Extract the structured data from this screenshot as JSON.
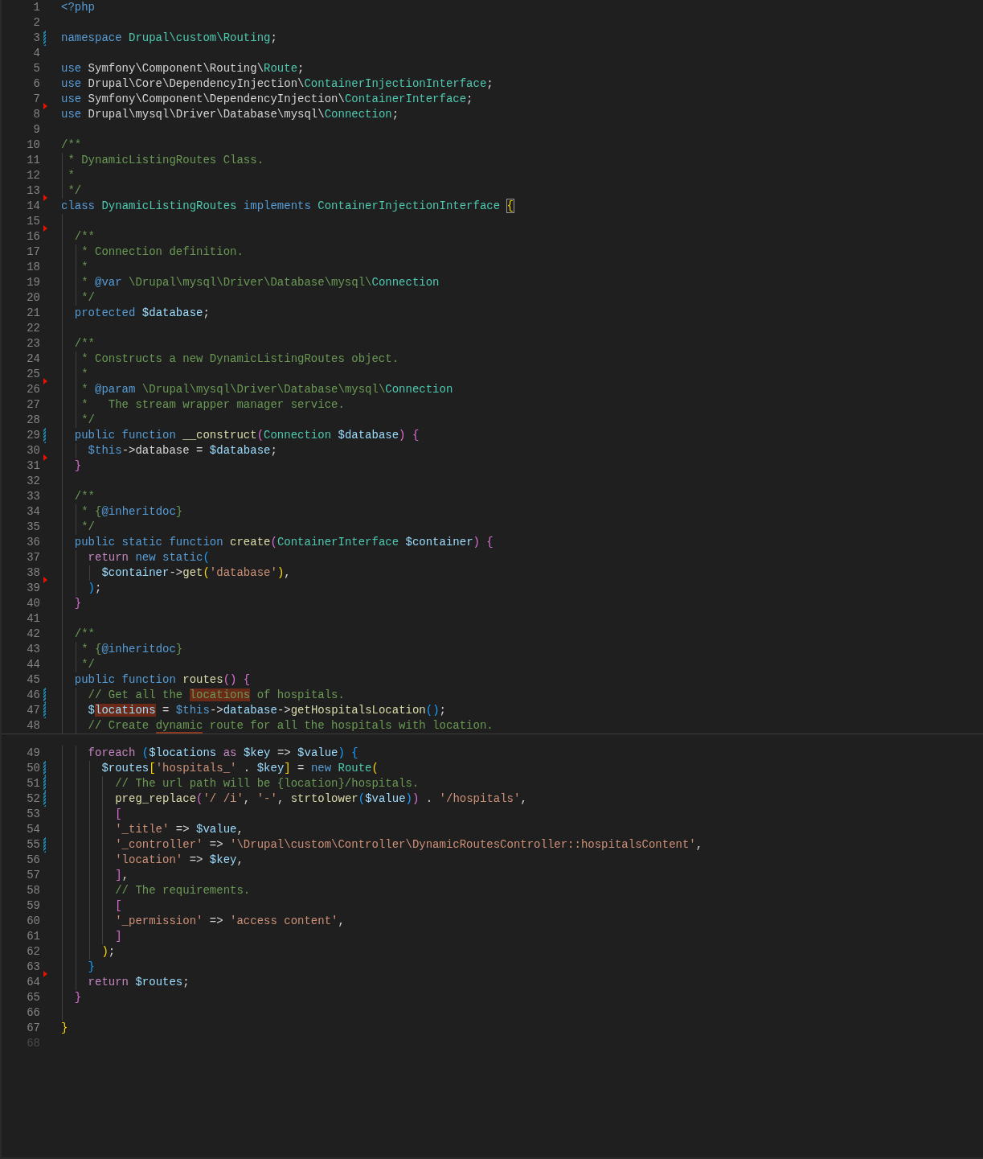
{
  "editor": {
    "sections": [
      {
        "lines": [
          {
            "number": "1",
            "modified": false,
            "marker": false,
            "dimmed": false,
            "tokens": [
              {
                "text": "<?php",
                "kind": "keyword"
              }
            ]
          },
          {
            "number": "2",
            "modified": false,
            "marker": false,
            "dimmed": false
          },
          {
            "number": "3",
            "modified": true,
            "marker": false,
            "dimmed": false,
            "tokens": [
              {
                "text": "namespace ",
                "kind": "keyword"
              },
              {
                "text": "Drupal\\custom\\Routing",
                "kind": "type"
              },
              {
                "text": ";",
                "kind": "plain"
              }
            ]
          },
          {
            "number": "4",
            "modified": false,
            "marker": false,
            "dimmed": false
          },
          {
            "number": "5",
            "modified": false,
            "marker": false,
            "dimmed": false,
            "tokens": [
              {
                "text": "use ",
                "kind": "keyword"
              },
              {
                "text": "Symfony\\Component\\Routing\\",
                "kind": "plain"
              },
              {
                "text": "Route",
                "kind": "type"
              },
              {
                "text": ";",
                "kind": "plain"
              }
            ]
          },
          {
            "number": "6",
            "modified": false,
            "marker": false,
            "dimmed": false,
            "tokens": [
              {
                "text": "use ",
                "kind": "keyword"
              },
              {
                "text": "Drupal\\Core\\DependencyInjection\\",
                "kind": "plain"
              },
              {
                "text": "ContainerInjectionInterface",
                "kind": "type"
              },
              {
                "text": ";",
                "kind": "plain"
              }
            ]
          },
          {
            "number": "7",
            "modified": false,
            "marker": false,
            "dimmed": false,
            "tokens": [
              {
                "text": "use ",
                "kind": "keyword"
              },
              {
                "text": "Symfony\\Component\\DependencyInjection\\",
                "kind": "plain"
              },
              {
                "text": "ContainerInterface",
                "kind": "type"
              },
              {
                "text": ";",
                "kind": "plain"
              }
            ]
          },
          {
            "number": "8",
            "modified": false,
            "marker": true,
            "dimmed": false,
            "tokens": [
              {
                "text": "use ",
                "kind": "keyword"
              },
              {
                "text": "Drupal\\mysql\\Driver\\Database\\mysql\\",
                "kind": "plain"
              },
              {
                "text": "Connection",
                "kind": "type"
              },
              {
                "text": ";",
                "kind": "plain"
              }
            ]
          },
          {
            "number": "9",
            "modified": false,
            "marker": false,
            "dimmed": false
          },
          {
            "number": "10",
            "modified": false,
            "marker": false,
            "dimmed": false,
            "tokens": [
              {
                "text": "/**",
                "kind": "comment"
              }
            ]
          },
          {
            "number": "11",
            "modified": false,
            "marker": false,
            "dimmed": false,
            "tokens": [
              {
                "text": " * DynamicListingRoutes Class.",
                "kind": "comment"
              }
            ]
          },
          {
            "number": "12",
            "modified": false,
            "marker": false,
            "dimmed": false,
            "tokens": [
              {
                "text": " *",
                "kind": "comment"
              }
            ]
          },
          {
            "number": "13",
            "modified": false,
            "marker": false,
            "dimmed": false,
            "tokens": [
              {
                "text": " */",
                "kind": "comment"
              }
            ]
          },
          {
            "number": "14",
            "modified": false,
            "marker": true,
            "dimmed": false,
            "tokens": [
              {
                "text": "class ",
                "kind": "keyword"
              },
              {
                "text": "DynamicListingRoutes ",
                "kind": "type"
              },
              {
                "text": "implements ",
                "kind": "keyword"
              },
              {
                "text": "ContainerInjectionInterface ",
                "kind": "type"
              },
              {
                "text": "{",
                "kind": "bracket_boxed"
              }
            ]
          },
          {
            "number": "15",
            "modified": false,
            "marker": false,
            "dimmed": false
          },
          {
            "number": "16",
            "modified": false,
            "marker": true,
            "dimmed": false,
            "tokens": [
              {
                "text": "  /**",
                "kind": "comment"
              }
            ]
          },
          {
            "number": "17",
            "modified": false,
            "marker": false,
            "dimmed": false,
            "tokens": [
              {
                "text": "   * Connection definition.",
                "kind": "comment"
              }
            ]
          },
          {
            "number": "18",
            "modified": false,
            "marker": false,
            "dimmed": false,
            "tokens": [
              {
                "text": "   *",
                "kind": "comment"
              }
            ]
          },
          {
            "number": "19",
            "modified": false,
            "marker": false,
            "dimmed": false,
            "tokens": [
              {
                "text": "   * ",
                "kind": "comment"
              },
              {
                "text": "@var",
                "kind": "keyword"
              },
              {
                "text": " \\Drupal\\mysql\\Driver\\Database\\mysql\\",
                "kind": "comment"
              },
              {
                "text": "Connection",
                "kind": "type"
              }
            ]
          },
          {
            "number": "20",
            "modified": false,
            "marker": false,
            "dimmed": false,
            "tokens": [
              {
                "text": "   */",
                "kind": "comment"
              }
            ]
          },
          {
            "number": "21",
            "modified": false,
            "marker": false,
            "dimmed": false,
            "tokens": [
              {
                "text": "  protected ",
                "kind": "keyword"
              },
              {
                "text": "$database",
                "kind": "variable"
              },
              {
                "text": ";",
                "kind": "plain"
              }
            ]
          },
          {
            "number": "22",
            "modified": false,
            "marker": false,
            "dimmed": false
          },
          {
            "number": "23",
            "modified": false,
            "marker": false,
            "dimmed": false,
            "tokens": [
              {
                "text": "  /**",
                "kind": "comment"
              }
            ]
          },
          {
            "number": "24",
            "modified": false,
            "marker": false,
            "dimmed": false,
            "tokens": [
              {
                "text": "   * Constructs a new DynamicListingRoutes object.",
                "kind": "comment"
              }
            ]
          },
          {
            "number": "25",
            "modified": false,
            "marker": false,
            "dimmed": false,
            "tokens": [
              {
                "text": "   *",
                "kind": "comment"
              }
            ]
          },
          {
            "number": "26",
            "modified": false,
            "marker": true,
            "dimmed": false,
            "tokens": [
              {
                "text": "   * ",
                "kind": "comment"
              },
              {
                "text": "@param",
                "kind": "keyword"
              },
              {
                "text": " \\Drupal\\mysql\\Driver\\Database\\mysql\\",
                "kind": "comment"
              },
              {
                "text": "Connection",
                "kind": "type"
              }
            ]
          },
          {
            "number": "27",
            "modified": false,
            "marker": false,
            "dimmed": false,
            "tokens": [
              {
                "text": "   *   The stream wrapper manager service.",
                "kind": "comment"
              }
            ]
          },
          {
            "number": "28",
            "modified": false,
            "marker": false,
            "dimmed": false,
            "tokens": [
              {
                "text": "   */",
                "kind": "comment"
              }
            ]
          },
          {
            "number": "29",
            "modified": true,
            "marker": false,
            "dimmed": false,
            "tokens": [
              {
                "text": "  public function ",
                "kind": "keyword"
              },
              {
                "text": "__construct",
                "kind": "function"
              },
              {
                "text": "(",
                "kind": "bracket2"
              },
              {
                "text": "Connection ",
                "kind": "type"
              },
              {
                "text": "$database",
                "kind": "variable"
              },
              {
                "text": ") {",
                "kind": "bracket2"
              }
            ]
          },
          {
            "number": "30",
            "modified": false,
            "marker": false,
            "dimmed": false,
            "tokens": [
              {
                "text": "    $this",
                "kind": "keyword"
              },
              {
                "text": "->database = ",
                "kind": "plain"
              },
              {
                "text": "$database",
                "kind": "variable"
              },
              {
                "text": ";",
                "kind": "plain"
              }
            ]
          },
          {
            "number": "31",
            "modified": false,
            "marker": true,
            "dimmed": false,
            "tokens": [
              {
                "text": "  }",
                "kind": "bracket2"
              }
            ]
          },
          {
            "number": "32",
            "modified": false,
            "marker": false,
            "dimmed": false
          },
          {
            "number": "33",
            "modified": false,
            "marker": false,
            "dimmed": false,
            "tokens": [
              {
                "text": "  /**",
                "kind": "comment"
              }
            ]
          },
          {
            "number": "34",
            "modified": false,
            "marker": false,
            "dimmed": false,
            "tokens": [
              {
                "text": "   * {",
                "kind": "comment"
              },
              {
                "text": "@inheritdoc",
                "kind": "keyword"
              },
              {
                "text": "}",
                "kind": "comment"
              }
            ]
          },
          {
            "number": "35",
            "modified": false,
            "marker": false,
            "dimmed": false,
            "tokens": [
              {
                "text": "   */",
                "kind": "comment"
              }
            ]
          },
          {
            "number": "36",
            "modified": false,
            "marker": false,
            "dimmed": false,
            "tokens": [
              {
                "text": "  public static function ",
                "kind": "keyword"
              },
              {
                "text": "create",
                "kind": "function"
              },
              {
                "text": "(",
                "kind": "bracket2"
              },
              {
                "text": "ContainerInterface ",
                "kind": "type"
              },
              {
                "text": "$container",
                "kind": "variable"
              },
              {
                "text": ") {",
                "kind": "bracket2"
              }
            ]
          },
          {
            "number": "37",
            "modified": false,
            "marker": false,
            "dimmed": false,
            "tokens": [
              {
                "text": "    return ",
                "kind": "control"
              },
              {
                "text": "new static",
                "kind": "keyword"
              },
              {
                "text": "(",
                "kind": "bracket3"
              }
            ]
          },
          {
            "number": "38",
            "modified": false,
            "marker": false,
            "dimmed": false,
            "tokens": [
              {
                "text": "      $container",
                "kind": "variable"
              },
              {
                "text": "->",
                "kind": "plain"
              },
              {
                "text": "get",
                "kind": "function"
              },
              {
                "text": "(",
                "kind": "bracket1"
              },
              {
                "text": "'database'",
                "kind": "string"
              },
              {
                "text": ")",
                "kind": "bracket1"
              },
              {
                "text": ",",
                "kind": "plain"
              }
            ]
          },
          {
            "number": "39",
            "modified": false,
            "marker": true,
            "dimmed": false,
            "tokens": [
              {
                "text": "    )",
                "kind": "bracket3"
              },
              {
                "text": ";",
                "kind": "plain"
              }
            ]
          },
          {
            "number": "40",
            "modified": false,
            "marker": false,
            "dimmed": false,
            "tokens": [
              {
                "text": "  }",
                "kind": "bracket2"
              }
            ]
          },
          {
            "number": "41",
            "modified": false,
            "marker": false,
            "dimmed": false
          },
          {
            "number": "42",
            "modified": false,
            "marker": false,
            "dimmed": false,
            "tokens": [
              {
                "text": "  /**",
                "kind": "comment"
              }
            ]
          },
          {
            "number": "43",
            "modified": false,
            "marker": false,
            "dimmed": false,
            "tokens": [
              {
                "text": "   * {",
                "kind": "comment"
              },
              {
                "text": "@inheritdoc",
                "kind": "keyword"
              },
              {
                "text": "}",
                "kind": "comment"
              }
            ]
          },
          {
            "number": "44",
            "modified": false,
            "marker": false,
            "dimmed": false,
            "tokens": [
              {
                "text": "   */",
                "kind": "comment"
              }
            ]
          },
          {
            "number": "45",
            "modified": false,
            "marker": false,
            "dimmed": false,
            "tokens": [
              {
                "text": "  public function ",
                "kind": "keyword"
              },
              {
                "text": "routes",
                "kind": "function"
              },
              {
                "text": "() {",
                "kind": "bracket2"
              }
            ]
          },
          {
            "number": "46",
            "modified": true,
            "marker": false,
            "dimmed": false,
            "tokens": [
              {
                "text": "    // Get all the ",
                "kind": "comment"
              },
              {
                "text": "locations",
                "kind": "comment_match"
              },
              {
                "text": " of hospitals.",
                "kind": "comment"
              }
            ]
          },
          {
            "number": "47",
            "modified": true,
            "marker": false,
            "dimmed": false,
            "tokens": [
              {
                "text": "    $",
                "kind": "variable"
              },
              {
                "text": "locations",
                "kind": "variable_match"
              },
              {
                "text": " = ",
                "kind": "plain"
              },
              {
                "text": "$this",
                "kind": "keyword"
              },
              {
                "text": "->",
                "kind": "plain"
              },
              {
                "text": "database",
                "kind": "variable"
              },
              {
                "text": "->",
                "kind": "plain"
              },
              {
                "text": "getHospitalsLocation",
                "kind": "function"
              },
              {
                "text": "()",
                "kind": "bracket3"
              },
              {
                "text": ";",
                "kind": "plain"
              }
            ]
          },
          {
            "number": "48",
            "modified": false,
            "marker": false,
            "dimmed": false,
            "tokens": [
              {
                "text": "    // Create ",
                "kind": "comment"
              },
              {
                "text": "dynamic",
                "kind": "comment_underlined"
              },
              {
                "text": " route for all the hospitals with location.",
                "kind": "comment"
              }
            ]
          }
        ]
      },
      {
        "lines": [
          {
            "number": "49",
            "modified": false,
            "marker": false,
            "dimmed": false,
            "tokens": [
              {
                "text": "    foreach ",
                "kind": "control"
              },
              {
                "text": "(",
                "kind": "bracket3"
              },
              {
                "text": "$locations ",
                "kind": "variable"
              },
              {
                "text": "as ",
                "kind": "control"
              },
              {
                "text": "$key ",
                "kind": "variable"
              },
              {
                "text": "=> ",
                "kind": "plain"
              },
              {
                "text": "$value",
                "kind": "variable"
              },
              {
                "text": ") {",
                "kind": "bracket3"
              }
            ]
          },
          {
            "number": "50",
            "modified": true,
            "marker": false,
            "dimmed": false,
            "tokens": [
              {
                "text": "      $routes",
                "kind": "variable"
              },
              {
                "text": "[",
                "kind": "bracket1"
              },
              {
                "text": "'hospitals_'",
                "kind": "string"
              },
              {
                "text": " . ",
                "kind": "plain"
              },
              {
                "text": "$key",
                "kind": "variable"
              },
              {
                "text": "]",
                "kind": "bracket1"
              },
              {
                "text": " = ",
                "kind": "plain"
              },
              {
                "text": "new ",
                "kind": "keyword"
              },
              {
                "text": "Route",
                "kind": "type"
              },
              {
                "text": "(",
                "kind": "bracket1"
              }
            ]
          },
          {
            "number": "51",
            "modified": true,
            "marker": false,
            "dimmed": false,
            "tokens": [
              {
                "text": "        // The url path will be {location}/hospitals.",
                "kind": "comment"
              }
            ]
          },
          {
            "number": "52",
            "modified": true,
            "marker": false,
            "dimmed": false,
            "tokens": [
              {
                "text": "        preg_replace",
                "kind": "function"
              },
              {
                "text": "(",
                "kind": "bracket2"
              },
              {
                "text": "'/ /i'",
                "kind": "string"
              },
              {
                "text": ", ",
                "kind": "plain"
              },
              {
                "text": "'-'",
                "kind": "string"
              },
              {
                "text": ", ",
                "kind": "plain"
              },
              {
                "text": "strtolower",
                "kind": "function"
              },
              {
                "text": "(",
                "kind": "bracket3"
              },
              {
                "text": "$value",
                "kind": "variable"
              },
              {
                "text": ")",
                "kind": "bracket3"
              },
              {
                "text": ")",
                "kind": "bracket2"
              },
              {
                "text": " . ",
                "kind": "plain"
              },
              {
                "text": "'/hospitals'",
                "kind": "string"
              },
              {
                "text": ",",
                "kind": "plain"
              }
            ]
          },
          {
            "number": "53",
            "modified": false,
            "marker": false,
            "dimmed": false,
            "tokens": [
              {
                "text": "        [",
                "kind": "bracket2"
              }
            ]
          },
          {
            "number": "54",
            "modified": false,
            "marker": false,
            "dimmed": false,
            "tokens": [
              {
                "text": "        '_title'",
                "kind": "string"
              },
              {
                "text": " => ",
                "kind": "plain"
              },
              {
                "text": "$value",
                "kind": "variable"
              },
              {
                "text": ",",
                "kind": "plain"
              }
            ]
          },
          {
            "number": "55",
            "modified": true,
            "marker": false,
            "dimmed": false,
            "tokens": [
              {
                "text": "        '_controller'",
                "kind": "string"
              },
              {
                "text": " => ",
                "kind": "plain"
              },
              {
                "text": "'\\Drupal\\custom\\Controller\\DynamicRoutesController::hospitalsContent'",
                "kind": "string"
              },
              {
                "text": ",",
                "kind": "plain"
              }
            ]
          },
          {
            "number": "56",
            "modified": false,
            "marker": false,
            "dimmed": false,
            "tokens": [
              {
                "text": "        'location'",
                "kind": "string"
              },
              {
                "text": " => ",
                "kind": "plain"
              },
              {
                "text": "$key",
                "kind": "variable"
              },
              {
                "text": ",",
                "kind": "plain"
              }
            ]
          },
          {
            "number": "57",
            "modified": false,
            "marker": false,
            "dimmed": false,
            "tokens": [
              {
                "text": "        ]",
                "kind": "bracket2"
              },
              {
                "text": ",",
                "kind": "plain"
              }
            ]
          },
          {
            "number": "58",
            "modified": false,
            "marker": false,
            "dimmed": false,
            "tokens": [
              {
                "text": "        // The requirements.",
                "kind": "comment"
              }
            ]
          },
          {
            "number": "59",
            "modified": false,
            "marker": false,
            "dimmed": false,
            "tokens": [
              {
                "text": "        [",
                "kind": "bracket2"
              }
            ]
          },
          {
            "number": "60",
            "modified": false,
            "marker": false,
            "dimmed": false,
            "tokens": [
              {
                "text": "        '_permission'",
                "kind": "string"
              },
              {
                "text": " => ",
                "kind": "plain"
              },
              {
                "text": "'access content'",
                "kind": "string"
              },
              {
                "text": ",",
                "kind": "plain"
              }
            ]
          },
          {
            "number": "61",
            "modified": false,
            "marker": false,
            "dimmed": false,
            "tokens": [
              {
                "text": "        ]",
                "kind": "bracket2"
              }
            ]
          },
          {
            "number": "62",
            "modified": false,
            "marker": false,
            "dimmed": false,
            "tokens": [
              {
                "text": "      )",
                "kind": "bracket1"
              },
              {
                "text": ";",
                "kind": "plain"
              }
            ]
          },
          {
            "number": "63",
            "modified": false,
            "marker": false,
            "dimmed": false,
            "tokens": [
              {
                "text": "    }",
                "kind": "bracket3"
              }
            ]
          },
          {
            "number": "64",
            "modified": false,
            "marker": true,
            "dimmed": false,
            "tokens": [
              {
                "text": "    return ",
                "kind": "control"
              },
              {
                "text": "$routes",
                "kind": "variable"
              },
              {
                "text": ";",
                "kind": "plain"
              }
            ]
          },
          {
            "number": "65",
            "modified": false,
            "marker": false,
            "dimmed": false,
            "tokens": [
              {
                "text": "  }",
                "kind": "bracket2"
              }
            ]
          },
          {
            "number": "66",
            "modified": false,
            "marker": false,
            "dimmed": false
          },
          {
            "number": "67",
            "modified": false,
            "marker": false,
            "dimmed": false,
            "tokens": [
              {
                "text": "}",
                "kind": "bracket1"
              }
            ]
          },
          {
            "number": "68",
            "modified": false,
            "marker": false,
            "dimmed": true
          }
        ]
      }
    ]
  }
}
